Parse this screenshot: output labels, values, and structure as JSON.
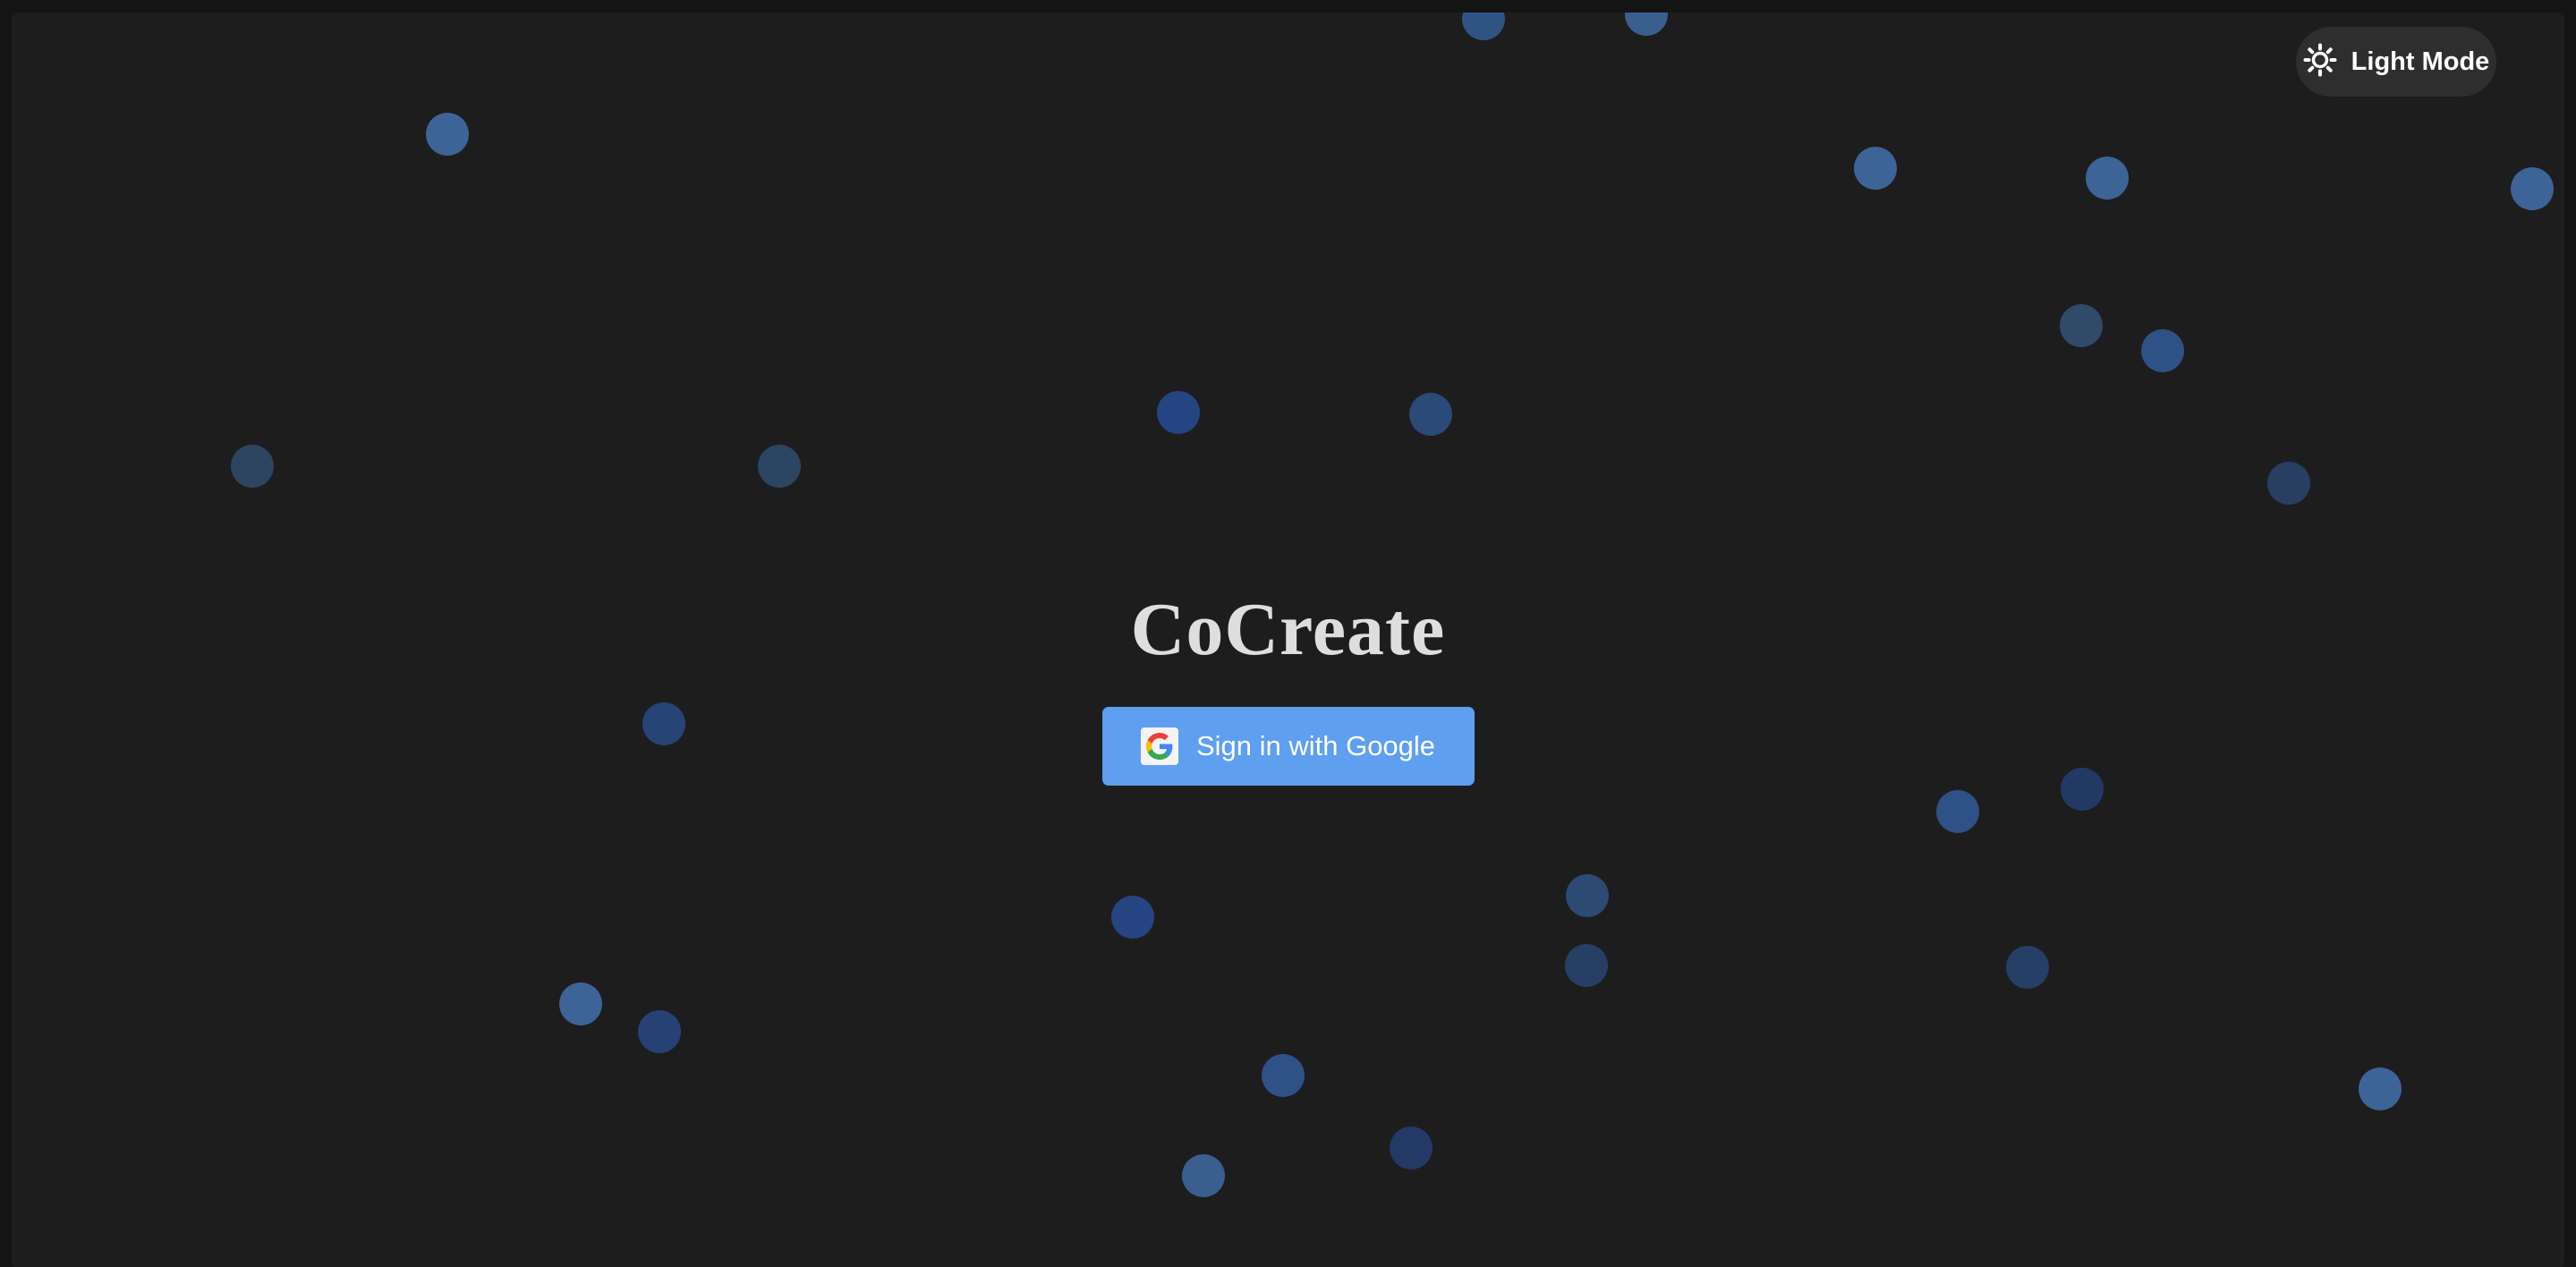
{
  "app": {
    "title": "CoCreate"
  },
  "theme_toggle": {
    "label": "Light Mode",
    "icon": "sun-icon"
  },
  "auth": {
    "google_button_label": "Sign in with Google",
    "google_icon": "google-g-icon"
  },
  "colors": {
    "background": "#1d1d1d",
    "button_blue": "#5e9fef",
    "toggle_bg": "#2e2e2e",
    "title_text": "#dedede",
    "dot_palette": [
      "#3d6496",
      "#2e5286",
      "#284777",
      "#223a63",
      "#304a6a"
    ]
  }
}
